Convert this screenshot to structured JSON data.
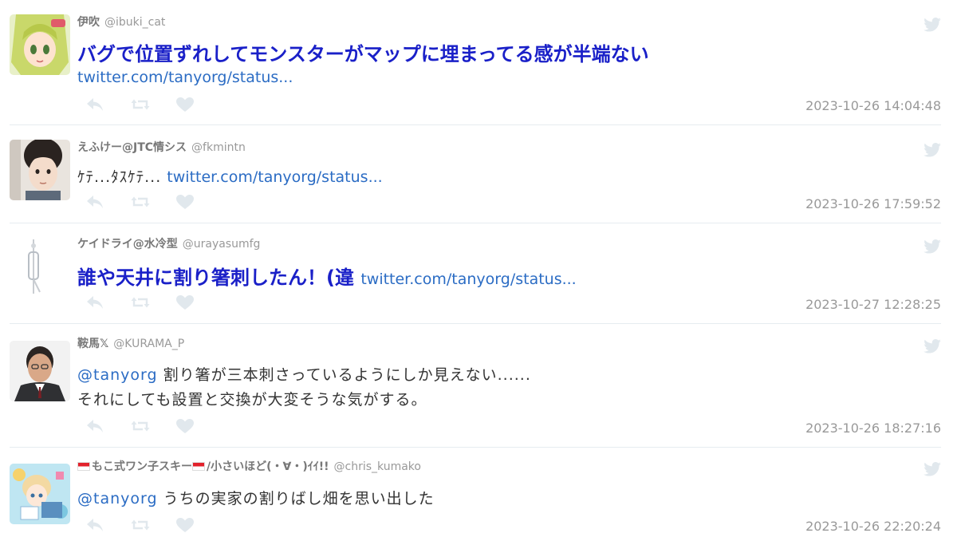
{
  "tweets": [
    {
      "name": "伊吹",
      "handle": "@ibuki_cat",
      "text": "バグで位置ずれしてモンスターがマップに埋まってる感が半端ない",
      "link": "twitter.com/tanyorg/status...",
      "time": "2023-10-26 14:04:48"
    },
    {
      "name": "えふけー@JTC情シス",
      "handle": "@fkmintn",
      "text": "ｹﾃ...ﾀｽｹﾃ...",
      "link": "twitter.com/tanyorg/status...",
      "time": "2023-10-26 17:59:52"
    },
    {
      "name": "ケイドライ@水冷型",
      "handle": "@urayasumfg",
      "text": "誰や天井に割り箸刺したん！(違",
      "link": "twitter.com/tanyorg/status...",
      "time": "2023-10-27 12:28:25"
    },
    {
      "name": "鞍馬𝕏",
      "handle": "@KURAMA_P",
      "mention": "@tanyorg",
      "text_line1": "割り箸が三本刺さっているようにしか見えない......",
      "text_line2": "それにしても設置と交換が大変そうな気がする。",
      "time": "2023-10-26 18:27:16"
    },
    {
      "name_part1": "もこ式ワン子スキー",
      "name_part2": "/小さいほど(・∀・)ｲｲ!!",
      "handle": "@chris_kumako",
      "mention": "@tanyorg",
      "text": "うちの実家の割りばし畑を思い出した",
      "time": "2023-10-26 22:20:24"
    }
  ],
  "icons": {
    "bird": "twitter-bird-icon",
    "reply": "reply-icon",
    "retweet": "retweet-icon",
    "like": "heart-icon",
    "flag": "indonesia-flag-icon"
  },
  "colors": {
    "name": "#777777",
    "handle": "#999999",
    "highlight_text": "#1a20c8",
    "link": "#2b6cc4",
    "icon": "#e1e8ed",
    "separator": "#e6ecf0"
  }
}
